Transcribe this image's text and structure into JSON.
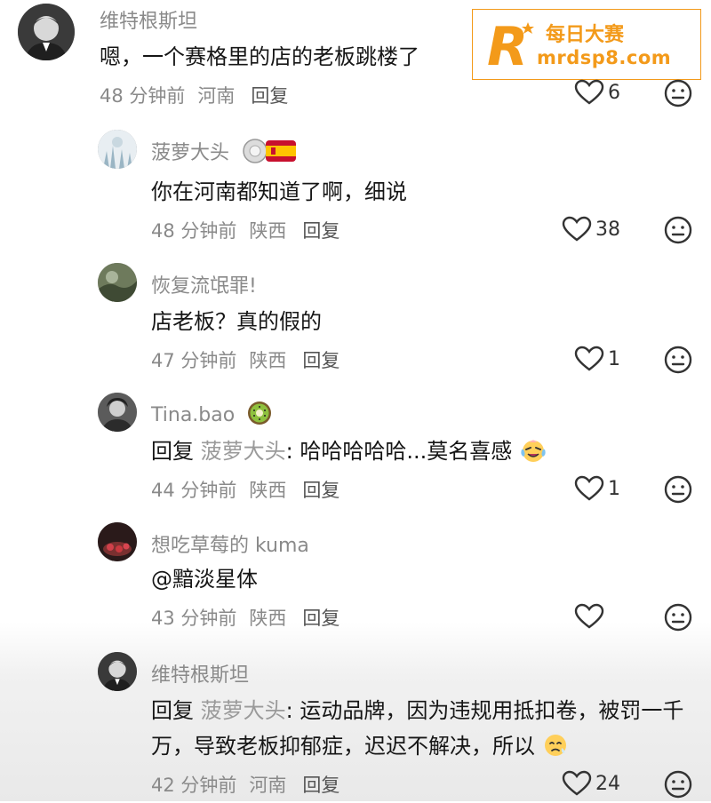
{
  "watermark": {
    "logo_letter": "R",
    "name": "每日大赛",
    "url": "mrdsp8.com"
  },
  "comments": [
    {
      "username": "维特根斯坦",
      "text": "嗯，一个赛格里的店的老板跳楼了",
      "time": "48 分钟前",
      "location": "河南",
      "reply_label": "回复",
      "likes": "6"
    },
    {
      "username": "菠萝大头",
      "badge": "spain-flag-badge",
      "text": "你在河南都知道了啊，细说",
      "time": "48 分钟前",
      "location": "陕西",
      "reply_label": "回复",
      "likes": "38"
    },
    {
      "username": "恢复流氓罪!",
      "text": "店老板？真的假的",
      "time": "47 分钟前",
      "location": "陕西",
      "reply_label": "回复",
      "likes": "1"
    },
    {
      "username": "Tina.bao",
      "badge": "kiwi-emoji",
      "reply_prefix": "回复",
      "reply_target": "菠萝大头",
      "text": ": 哈哈哈哈哈...莫名喜感",
      "time": "44 分钟前",
      "location": "陕西",
      "reply_label": "回复",
      "likes": "1"
    },
    {
      "username": "想吃草莓的 kuma",
      "text": "@黯淡星体",
      "time": "43 分钟前",
      "location": "陕西",
      "reply_label": "回复",
      "likes": ""
    },
    {
      "username": "维特根斯坦",
      "reply_prefix": "回复",
      "reply_target": "菠萝大头",
      "text": ": 运动品牌，因为违规用抵扣卷，被罚一千万，导致老板抑郁症，迟迟不解决，所以",
      "time": "42 分钟前",
      "location": "河南",
      "reply_label": "回复",
      "likes": "24"
    }
  ],
  "colors": {
    "accent": "#f39a1a",
    "muted": "#8a8a8a",
    "text": "#161616"
  }
}
